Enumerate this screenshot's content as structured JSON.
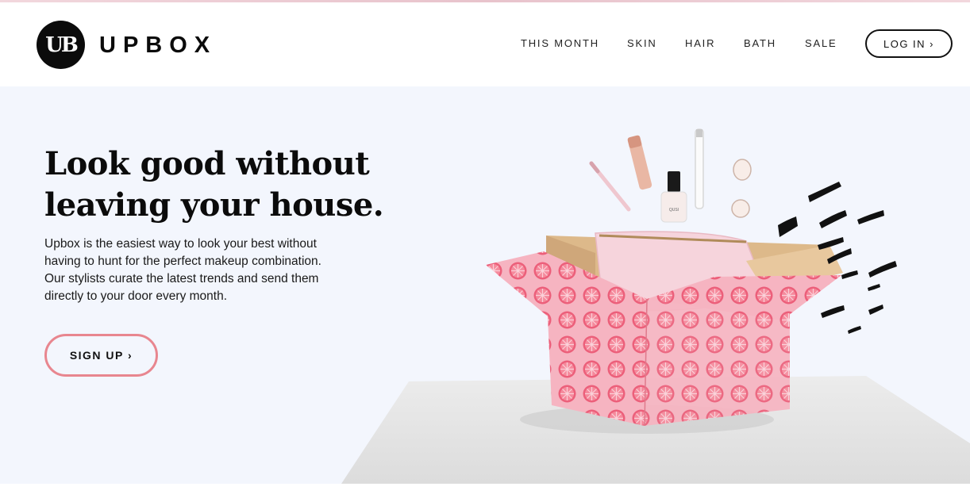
{
  "brand": {
    "logo_text": "UB",
    "name": "UPBOX"
  },
  "nav": {
    "items": [
      "THIS MONTH",
      "SKIN",
      "HAIR",
      "BATH",
      "SALE"
    ],
    "login_label": "LOG IN ›"
  },
  "hero": {
    "title_line1": "Look good without",
    "title_line2": "leaving your house.",
    "text_line1": "Upbox is the easiest way to look your best without",
    "text_line2": "having to hunt for the perfect makeup combination.",
    "text_line3": "Our stylists curate the latest trends and send them",
    "text_line4": "directly to your door every month.",
    "signup_label": "SIGN UP ›",
    "polish_label": "QUSI"
  },
  "colors": {
    "hero_bg": "#f3f6fd",
    "accent_pink": "#e8868f",
    "box_pink": "#f4a7b7",
    "text_dark": "#0b0b0b"
  }
}
